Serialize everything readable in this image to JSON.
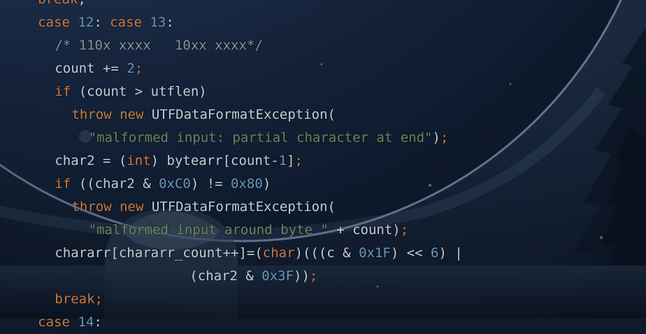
{
  "editor": {
    "language": "java",
    "lines": [
      {
        "indent": 4,
        "tokens": [
          {
            "t": "kw",
            "v": "break"
          },
          {
            "t": "pl",
            "v": ";"
          }
        ]
      },
      {
        "indent": 4,
        "tokens": [
          {
            "t": "kw",
            "v": "case "
          },
          {
            "t": "num",
            "v": "12"
          },
          {
            "t": "pl",
            "v": ": "
          },
          {
            "t": "kw",
            "v": "case "
          },
          {
            "t": "num",
            "v": "13"
          },
          {
            "t": "pl",
            "v": ":"
          }
        ]
      },
      {
        "indent": 6,
        "tokens": [
          {
            "t": "cmt",
            "v": "/* 110x xxxx   10xx xxxx*/"
          }
        ]
      },
      {
        "indent": 6,
        "tokens": [
          {
            "t": "pl",
            "v": "count += "
          },
          {
            "t": "num",
            "v": "2"
          },
          {
            "t": "kw",
            "v": ";"
          }
        ]
      },
      {
        "indent": 6,
        "tokens": [
          {
            "t": "kw",
            "v": "if "
          },
          {
            "t": "pl",
            "v": "(count > utflen)"
          }
        ]
      },
      {
        "indent": 8,
        "tokens": [
          {
            "t": "kw",
            "v": "throw new "
          },
          {
            "t": "pl",
            "v": "UTFDataFormatException("
          }
        ]
      },
      {
        "indent": 10,
        "tokens": [
          {
            "t": "str",
            "v": "\"malformed input: partial character at end\""
          },
          {
            "t": "pl",
            "v": ")"
          },
          {
            "t": "kw",
            "v": ";"
          }
        ]
      },
      {
        "indent": 6,
        "tokens": [
          {
            "t": "pl",
            "v": "char2 = ("
          },
          {
            "t": "kw",
            "v": "int"
          },
          {
            "t": "pl",
            "v": ") bytearr[count-"
          },
          {
            "t": "num",
            "v": "1"
          },
          {
            "t": "pl",
            "v": "]"
          },
          {
            "t": "kw",
            "v": ";"
          }
        ]
      },
      {
        "indent": 6,
        "tokens": [
          {
            "t": "kw",
            "v": "if "
          },
          {
            "t": "pl",
            "v": "((char2 & "
          },
          {
            "t": "num",
            "v": "0xC0"
          },
          {
            "t": "pl",
            "v": ") != "
          },
          {
            "t": "num",
            "v": "0x80"
          },
          {
            "t": "pl",
            "v": ")"
          }
        ]
      },
      {
        "indent": 8,
        "tokens": [
          {
            "t": "kw",
            "v": "throw new "
          },
          {
            "t": "pl",
            "v": "UTFDataFormatException("
          }
        ]
      },
      {
        "indent": 10,
        "tokens": [
          {
            "t": "str",
            "v": "\"malformed input around byte \""
          },
          {
            "t": "pl",
            "v": " + count)"
          },
          {
            "t": "kw",
            "v": ";"
          }
        ]
      },
      {
        "indent": 6,
        "tokens": [
          {
            "t": "pl",
            "v": "chararr[chararr_count++]=("
          },
          {
            "t": "kw",
            "v": "char"
          },
          {
            "t": "pl",
            "v": ")(((c & "
          },
          {
            "t": "num",
            "v": "0x1F"
          },
          {
            "t": "pl",
            "v": ") << "
          },
          {
            "t": "num",
            "v": "6"
          },
          {
            "t": "pl",
            "v": ") |"
          }
        ]
      },
      {
        "indent": 22,
        "tokens": [
          {
            "t": "pl",
            "v": "(char2 & "
          },
          {
            "t": "num",
            "v": "0x3F"
          },
          {
            "t": "pl",
            "v": "))"
          },
          {
            "t": "kw",
            "v": ";"
          }
        ]
      },
      {
        "indent": 6,
        "tokens": [
          {
            "t": "kw",
            "v": "break;"
          }
        ]
      },
      {
        "indent": 4,
        "tokens": [
          {
            "t": "kw",
            "v": "case "
          },
          {
            "t": "num",
            "v": "14"
          },
          {
            "t": "pl",
            "v": ":"
          }
        ]
      }
    ]
  },
  "colors": {
    "keyword": "#cc7a3e",
    "number": "#6897bb",
    "string": "#6a8759",
    "comment": "#8a8f96",
    "plain": "#c6cdd6"
  }
}
